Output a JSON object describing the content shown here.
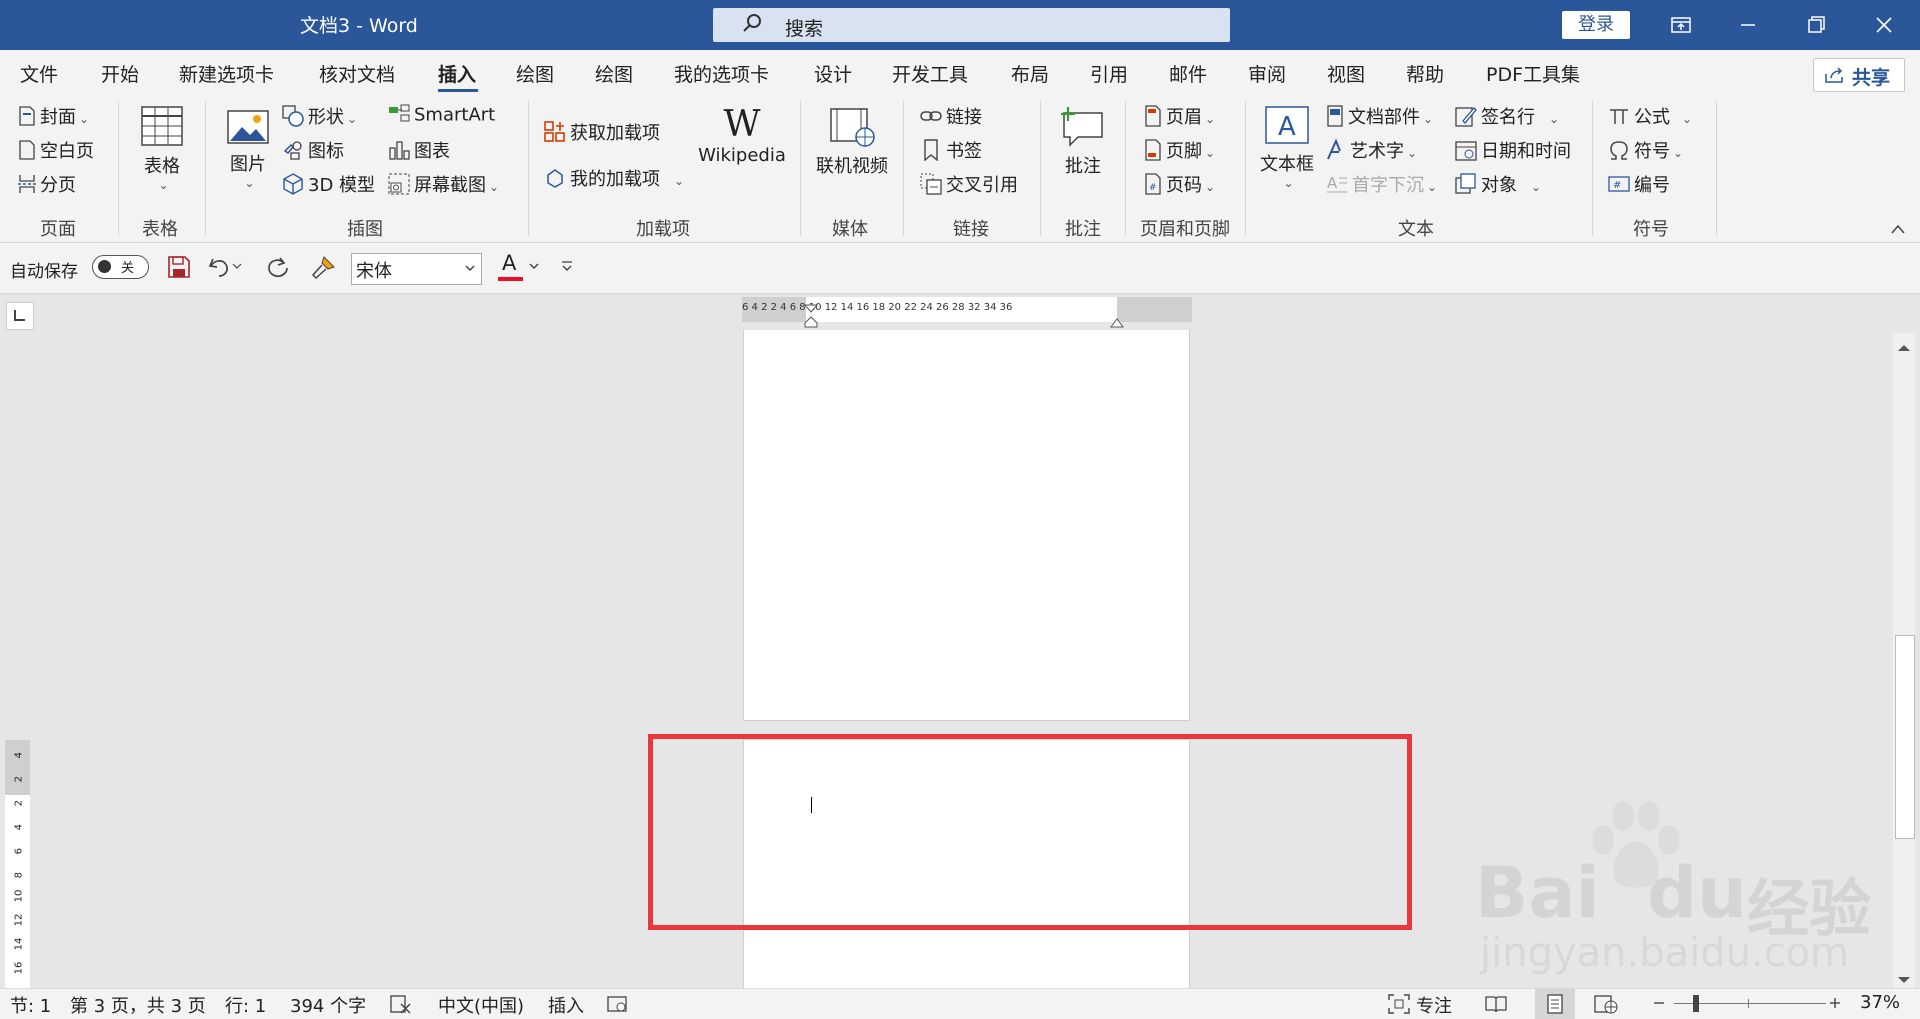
{
  "titlebar": {
    "title": "文档3  -  Word",
    "search_placeholder": "搜索",
    "login": "登录"
  },
  "menu": {
    "items": [
      "文件",
      "开始",
      "新建选项卡",
      "核对文档",
      "插入",
      "绘图",
      "绘图",
      "我的选项卡",
      "设计",
      "开发工具",
      "布局",
      "引用",
      "邮件",
      "审阅",
      "视图",
      "帮助",
      "PDF工具集"
    ],
    "active": "插入",
    "share": "共享"
  },
  "ribbon": {
    "pages": {
      "cover": "封面",
      "blank": "空白页",
      "break": "分页",
      "label": "页面"
    },
    "table": {
      "button": "表格",
      "label": "表格"
    },
    "illustrations": {
      "picture": "图片",
      "shapes": "形状",
      "icons": "图标",
      "model3d": "3D 模型",
      "smartart": "SmartArt",
      "chart": "图表",
      "screenshot": "屏幕截图",
      "label": "插图"
    },
    "addins": {
      "get": "获取加载项",
      "my": "我的加载项",
      "wikipedia": "Wikipedia",
      "label": "加载项"
    },
    "media": {
      "video": "联机视频",
      "label": "媒体"
    },
    "links": {
      "link": "链接",
      "bookmark": "书签",
      "crossref": "交叉引用",
      "label": "链接"
    },
    "comments": {
      "comment": "批注",
      "label": "批注"
    },
    "headerfooter": {
      "header": "页眉",
      "footer": "页脚",
      "pagenum": "页码",
      "label": "页眉和页脚"
    },
    "text": {
      "textbox": "文本框",
      "quickparts": "文档部件",
      "wordart": "艺术字",
      "dropcap": "首字下沉",
      "signature": "签名行",
      "datetime": "日期和时间",
      "object": "对象",
      "label": "文本"
    },
    "symbols": {
      "equation": "公式",
      "symbol": "符号",
      "number": "编号",
      "label": "符号"
    }
  },
  "qat": {
    "autosave": "自动保存",
    "toggle": "关",
    "font": "宋体",
    "font_color_letter": "A"
  },
  "ruler": {
    "h_ticks": "6   4   2         2    4    6    8   10  12  14  16  18  20  22  24  26  28      32  34  36",
    "v_ticks": [
      "4",
      "2",
      "2",
      "4",
      "6",
      "8",
      "10",
      "12",
      "14",
      "16"
    ]
  },
  "status": {
    "section": "节: 1",
    "page": "第 3 页，共 3 页",
    "line": "行: 1",
    "words": "394 个字",
    "language": "中文(中国)",
    "mode": "插入",
    "focus": "专注",
    "zoom": "37%"
  },
  "watermark": {
    "brand": "Bai",
    "brand2": "du",
    "cn": "经验",
    "url": "jingyan.baidu.com"
  },
  "colors": {
    "accent": "#2b579a",
    "highlight": "#e8383d",
    "font_color": "#e81123"
  }
}
